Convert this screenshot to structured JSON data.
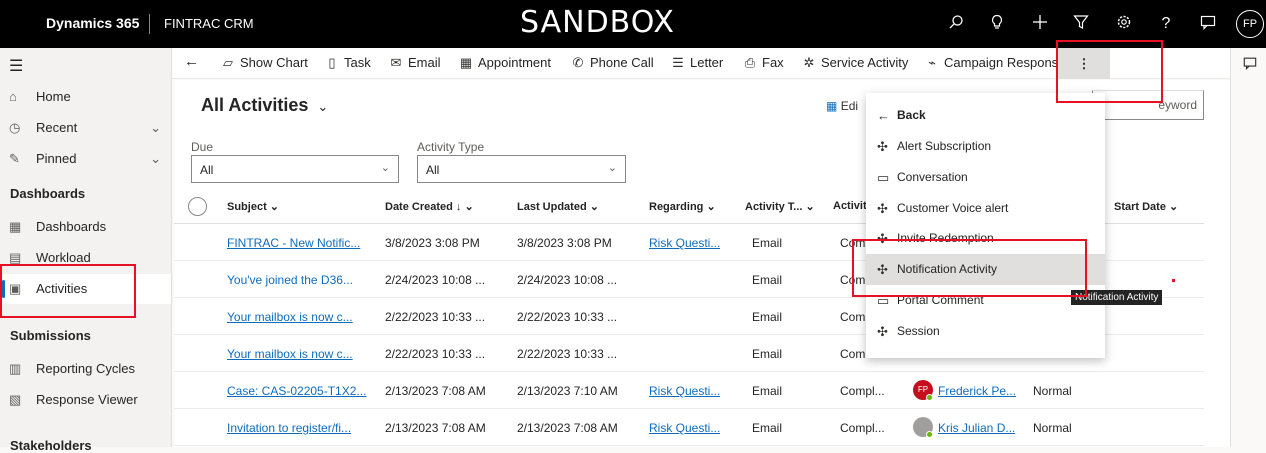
{
  "header": {
    "brand": "Dynamics 365",
    "app_name": "FINTRAC CRM",
    "environment": "SANDBOX",
    "icons": [
      "search-icon",
      "lightbulb-icon",
      "plus-icon",
      "filter-icon",
      "gear-icon",
      "help-icon",
      "chat-icon"
    ],
    "avatar_initials": "FP"
  },
  "nav": {
    "items": [
      {
        "label": "Home",
        "icon": "home-icon"
      },
      {
        "label": "Recent",
        "icon": "clock-icon"
      },
      {
        "label": "Pinned",
        "icon": "pin-icon"
      }
    ],
    "groups": [
      {
        "title": "Dashboards",
        "items": [
          {
            "label": "Dashboards",
            "icon": "dashboard-icon"
          },
          {
            "label": "Workload",
            "icon": "workload-icon"
          },
          {
            "label": "Activities",
            "icon": "activity-icon",
            "active": true
          }
        ]
      },
      {
        "title": "Submissions",
        "items": [
          {
            "label": "Reporting Cycles",
            "icon": "cycle-icon"
          },
          {
            "label": "Response Viewer",
            "icon": "viewer-icon"
          }
        ]
      },
      {
        "title": "Stakeholders",
        "items": []
      }
    ]
  },
  "commandbar": {
    "buttons": [
      {
        "label": "Show Chart",
        "icon": "chart-icon"
      },
      {
        "label": "Task",
        "icon": "task-icon"
      },
      {
        "label": "Email",
        "icon": "email-icon"
      },
      {
        "label": "Appointment",
        "icon": "calendar-icon"
      },
      {
        "label": "Phone Call",
        "icon": "phone-icon"
      },
      {
        "label": "Letter",
        "icon": "letter-icon"
      },
      {
        "label": "Fax",
        "icon": "fax-icon"
      },
      {
        "label": "Service Activity",
        "icon": "service-icon"
      },
      {
        "label": "Campaign Response",
        "icon": "campaign-icon"
      }
    ],
    "more_label": "⋮"
  },
  "view": {
    "title": "All Activities",
    "edit_label": "Edi",
    "search_placeholder": "eyword"
  },
  "filters": [
    {
      "label": "Due",
      "value": "All"
    },
    {
      "label": "Activity Type",
      "value": "All"
    }
  ],
  "grid": {
    "headers": [
      "Subject",
      "Date Created",
      "Last Updated",
      "Regarding",
      "Activity T...",
      "Activity",
      "Start Date"
    ],
    "rows": [
      {
        "subject": "FINTRAC - New Notific...",
        "created": "3/8/2023 3:08 PM",
        "updated": "3/8/2023 3:08 PM",
        "regarding": "Risk Questi...",
        "type": "Email",
        "status": "Com",
        "owner": "",
        "owner_initials": "",
        "priority": ""
      },
      {
        "subject": "You've joined the D36...",
        "created": "2/24/2023 10:08 ...",
        "updated": "2/24/2023 10:08 ...",
        "regarding": "",
        "type": "Email",
        "status": "Com",
        "owner": "",
        "owner_initials": "",
        "priority": ""
      },
      {
        "subject": "Your mailbox is now c...",
        "created": "2/22/2023 10:33 ...",
        "updated": "2/22/2023 10:33 ...",
        "regarding": "",
        "type": "Email",
        "status": "Com",
        "owner": "",
        "owner_initials": "",
        "priority": ""
      },
      {
        "subject": "Your mailbox is now c...",
        "created": "2/22/2023 10:33 ...",
        "updated": "2/22/2023 10:33 ...",
        "regarding": "",
        "type": "Email",
        "status": "Com",
        "owner": "",
        "owner_initials": "",
        "priority": ""
      },
      {
        "subject": "Case: CAS-02205-T1X2...",
        "created": "2/13/2023 7:08 AM",
        "updated": "2/13/2023 7:10 AM",
        "regarding": "Risk Questi...",
        "type": "Email",
        "status": "Compl...",
        "owner": "Frederick Pe...",
        "owner_initials": "FP",
        "priority": "Normal"
      },
      {
        "subject": "Invitation to register/fi...",
        "created": "2/13/2023 7:08 AM",
        "updated": "2/13/2023 7:08 AM",
        "regarding": "Risk Questi...",
        "type": "Email",
        "status": "Compl...",
        "owner": "Kris Julian D...",
        "owner_initials": "",
        "priority": "Normal"
      }
    ]
  },
  "menu": {
    "back_label": "Back",
    "items": [
      {
        "label": "Alert Subscription",
        "icon": "puzzle-icon"
      },
      {
        "label": "Conversation",
        "icon": "conversation-icon"
      },
      {
        "label": "Customer Voice alert",
        "icon": "puzzle-icon"
      },
      {
        "label": "Invite Redemption",
        "icon": "puzzle-icon"
      },
      {
        "label": "Notification Activity",
        "icon": "puzzle-icon"
      },
      {
        "label": "Portal Comment",
        "icon": "comment-icon"
      },
      {
        "label": "Session",
        "icon": "puzzle-icon"
      }
    ],
    "tooltip": "Notification Activity"
  },
  "colors": {
    "accent": "#0f6cbd",
    "highlight_box": "#e81123",
    "header_bg": "#000000"
  }
}
